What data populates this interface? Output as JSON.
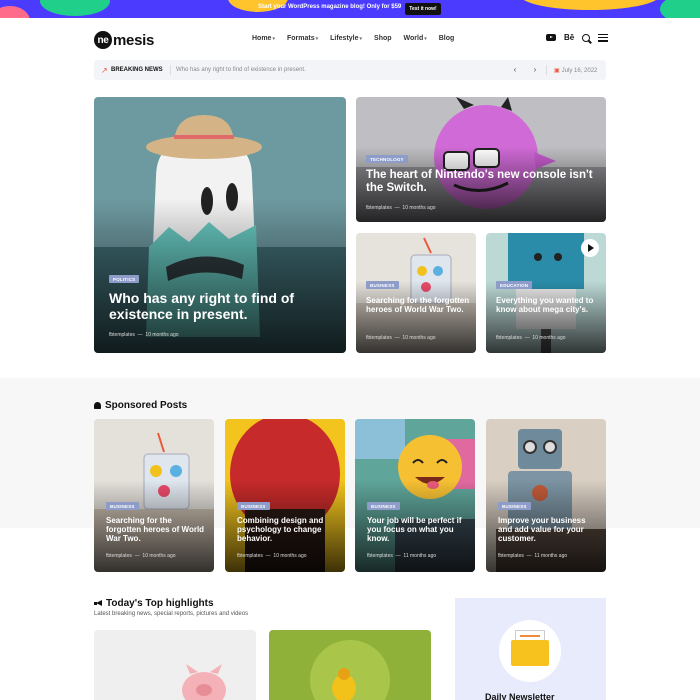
{
  "promo": {
    "text": "Start your WordPress magazine blog! Only for $59",
    "button": "Test it now!"
  },
  "brand": {
    "logo_mark": "ne",
    "logo_rest": "mesis"
  },
  "nav": [
    {
      "label": "Home",
      "caret": "▾"
    },
    {
      "label": "Formats",
      "caret": "▾"
    },
    {
      "label": "Lifestyle",
      "caret": "▾"
    },
    {
      "label": "Shop",
      "caret": ""
    },
    {
      "label": "World",
      "caret": "▾"
    },
    {
      "label": "Blog",
      "caret": ""
    }
  ],
  "header_icons": {
    "behance": "Bē"
  },
  "breaking": {
    "label": "BREAKING NEWS",
    "text": "Who has any right to find of existence in present.",
    "prev": "‹",
    "next": "›",
    "date": "July 16, 2022"
  },
  "featured": [
    {
      "category": "POLITICS",
      "title": "Who has any right to find of existence in present.",
      "author": "fbtemplates",
      "sep": "—",
      "time": "10 months ago"
    },
    {
      "category": "TECHNOLOGY",
      "title": "The heart of Nintendo's new console isn't the Switch.",
      "author": "fbtemplates",
      "sep": "—",
      "time": "10 months ago"
    },
    {
      "category": "BUSINESS",
      "title": "Searching for the forgotten heroes of World War Two.",
      "author": "fbtemplates",
      "sep": "—",
      "time": "10 months ago"
    },
    {
      "category": "EDUCATION",
      "title": "Everything you wanted to know about mega city's.",
      "author": "fbtemplates",
      "sep": "—",
      "time": "10 months ago"
    }
  ],
  "sponsored": {
    "heading": "Sponsored Posts",
    "posts": [
      {
        "category": "BUSINESS",
        "title": "Searching for the forgotten heroes of World War Two.",
        "author": "fbtemplates",
        "sep": "—",
        "time": "10 months ago"
      },
      {
        "category": "BUSINESS",
        "title": "Combining design and psychology to change behavior.",
        "author": "fbtemplates",
        "sep": "—",
        "time": "10 months ago"
      },
      {
        "category": "BUSINESS",
        "title": "Your job will be perfect if you focus on what you know.",
        "author": "fbtemplates",
        "sep": "—",
        "time": "11 months ago"
      },
      {
        "category": "BUSINESS",
        "title": "Improve your business and add value for your customer.",
        "author": "fbtemplates",
        "sep": "—",
        "time": "11 months ago"
      }
    ]
  },
  "highlights": {
    "heading": "Today's Top highlights",
    "subtitle": "Latest breaking news, special reports, pictures and videos"
  },
  "newsletter": {
    "title": "Daily Newsletter"
  }
}
